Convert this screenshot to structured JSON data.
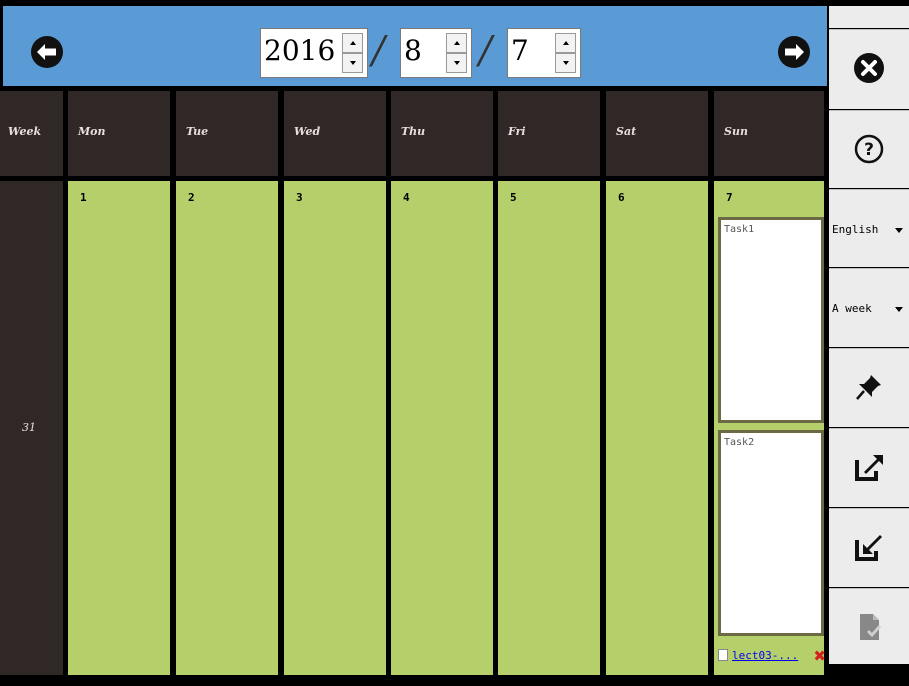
{
  "nav": {
    "year": "2016",
    "month": "8",
    "day": "7",
    "separator": "/"
  },
  "header": {
    "week_label": "Week",
    "days": [
      "Mon",
      "Tue",
      "Wed",
      "Thu",
      "Fri",
      "Sat",
      "Sun"
    ]
  },
  "week": {
    "number": "31",
    "dates": [
      "1",
      "2",
      "3",
      "4",
      "5",
      "6",
      "7"
    ]
  },
  "sunday": {
    "tasks": [
      "Task1",
      "Task2"
    ],
    "attachment": "lect03-..."
  },
  "sidebar": {
    "language": "English",
    "range": "A week",
    "icons": [
      "close-icon",
      "help-icon",
      "pin-icon",
      "export-icon",
      "import-icon",
      "file-icon"
    ]
  },
  "colors": {
    "topbar": "#5b9bd5",
    "header_bg": "#302826",
    "day_bg": "#b5cf6b",
    "sidebar_bg": "#ececec"
  }
}
